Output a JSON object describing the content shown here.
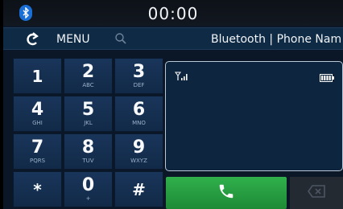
{
  "status_bar": {
    "clock": "00:00",
    "bluetooth_icon": "bluetooth-icon"
  },
  "menu_bar": {
    "back_icon": "back-arrow-icon",
    "menu_label": "MENU",
    "search_icon": "search-icon",
    "title": "Bluetooth | Phone Nam"
  },
  "keypad": {
    "keys": [
      {
        "digit": "1",
        "letters": ""
      },
      {
        "digit": "2",
        "letters": "ABC"
      },
      {
        "digit": "3",
        "letters": "DEF"
      },
      {
        "digit": "4",
        "letters": "GHI"
      },
      {
        "digit": "5",
        "letters": "JKL"
      },
      {
        "digit": "6",
        "letters": "MNO"
      },
      {
        "digit": "7",
        "letters": "PQRS"
      },
      {
        "digit": "8",
        "letters": "TUV"
      },
      {
        "digit": "9",
        "letters": "WXYZ"
      },
      {
        "digit": "*",
        "letters": ""
      },
      {
        "digit": "0",
        "letters": "+"
      },
      {
        "digit": "#",
        "letters": ""
      }
    ]
  },
  "display": {
    "number": "",
    "signal_icon": "signal-icon",
    "battery_icon": "battery-icon"
  },
  "actions": {
    "call_icon": "phone-call-icon",
    "delete_icon": "backspace-icon"
  },
  "colors": {
    "background": "#0b1726",
    "key": "#19355a",
    "call": "#2aa046",
    "bluetooth": "#1a6fd6"
  }
}
